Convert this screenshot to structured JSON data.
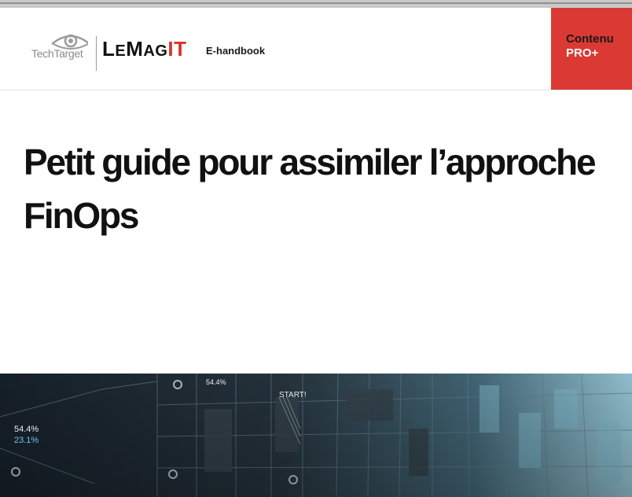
{
  "header": {
    "techtarget_logo": "TechTarget",
    "lemagit_logo": {
      "part1": "L",
      "part2": "E",
      "part3": "M",
      "part4": "AG",
      "part5": "IT"
    },
    "publication_type": "E-handbook",
    "badge": {
      "line1": "Contenu",
      "line2": "PRO+"
    }
  },
  "document": {
    "title": "Petit guide pour assimiler l’approche FinOps"
  },
  "hero_image": {
    "overlay_texts": [
      "54.4%",
      "23.1%",
      "54.4%",
      "START!"
    ]
  },
  "colors": {
    "brand_red": "#da3a33",
    "logo_it_red": "#d9322b",
    "hero_dark": "#1e2a33",
    "hero_light": "#8fd0e4"
  }
}
